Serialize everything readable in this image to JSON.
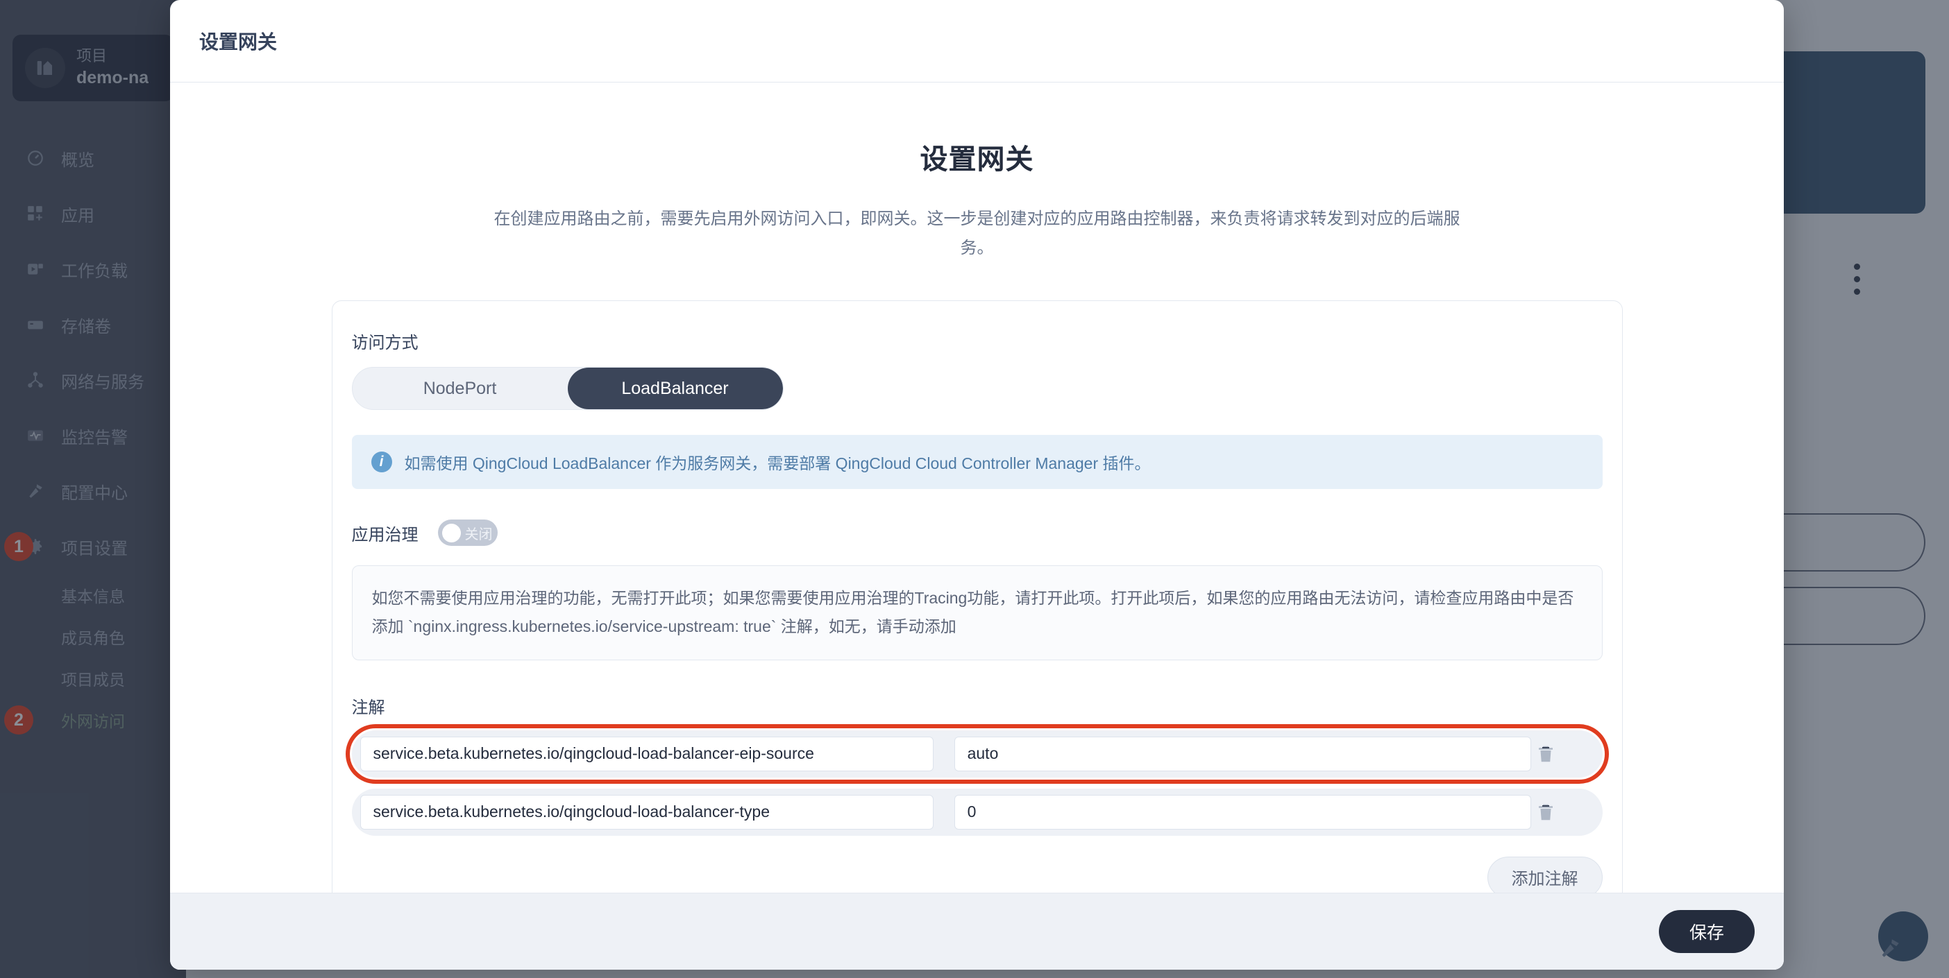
{
  "sidebar": {
    "project": {
      "label": "项目",
      "name": "demo-na"
    },
    "items": [
      {
        "label": "概览",
        "icon": "gauge-icon"
      },
      {
        "label": "应用",
        "icon": "apps-icon"
      },
      {
        "label": "工作负载",
        "icon": "workload-icon"
      },
      {
        "label": "存储卷",
        "icon": "storage-icon"
      },
      {
        "label": "网络与服务",
        "icon": "network-icon"
      },
      {
        "label": "监控告警",
        "icon": "monitor-icon"
      },
      {
        "label": "配置中心",
        "icon": "hammer-icon"
      },
      {
        "label": "项目设置",
        "icon": "gear-icon",
        "badge": "1"
      }
    ],
    "sub_items": [
      {
        "label": "基本信息"
      },
      {
        "label": "成员角色"
      },
      {
        "label": "项目成员"
      },
      {
        "label": "外网访问",
        "badge": "2",
        "active": true
      }
    ]
  },
  "modal": {
    "header_title": "设置网关",
    "hero_title": "设置网关",
    "hero_desc": "在创建应用路由之前，需要先启用外网访问入口，即网关。这一步是创建对应的应用路由控制器，来负责将请求转发到对应的后端服务。",
    "access": {
      "label": "访问方式",
      "options": [
        {
          "label": "NodePort",
          "selected": false
        },
        {
          "label": "LoadBalancer",
          "selected": true
        }
      ]
    },
    "info_banner": {
      "icon": "info-icon",
      "text": "如需使用 QingCloud LoadBalancer 作为服务网关，需要部署 QingCloud Cloud Controller Manager 插件。"
    },
    "governance": {
      "label": "应用治理",
      "toggle_state": "关闭",
      "description": "如您不需要使用应用治理的功能，无需打开此项；如果您需要使用应用治理的Tracing功能，请打开此项。打开此项后，如果您的应用路由无法访问，请检查应用路由中是否添加 `nginx.ingress.kubernetes.io/service-upstream: true` 注解，如无，请手动添加"
    },
    "annotations": {
      "label": "注解",
      "rows": [
        {
          "key": "service.beta.kubernetes.io/qingcloud-load-balancer-eip-source",
          "value": "auto",
          "highlighted": true,
          "delete_icon": "trash-icon"
        },
        {
          "key": "service.beta.kubernetes.io/qingcloud-load-balancer-type",
          "value": "0",
          "highlighted": false,
          "delete_icon": "trash-icon"
        }
      ],
      "add_label": "添加注解"
    },
    "footer": {
      "save_label": "保存"
    }
  },
  "background": {
    "fab_icon": "hammer-icon",
    "more_icon": "more-vertical-icon"
  },
  "colors": {
    "accent_dark": "#242c3d",
    "highlight_red": "#e03c1f",
    "info_blue": "#64a0d0",
    "sidebar": "#4a5161"
  }
}
